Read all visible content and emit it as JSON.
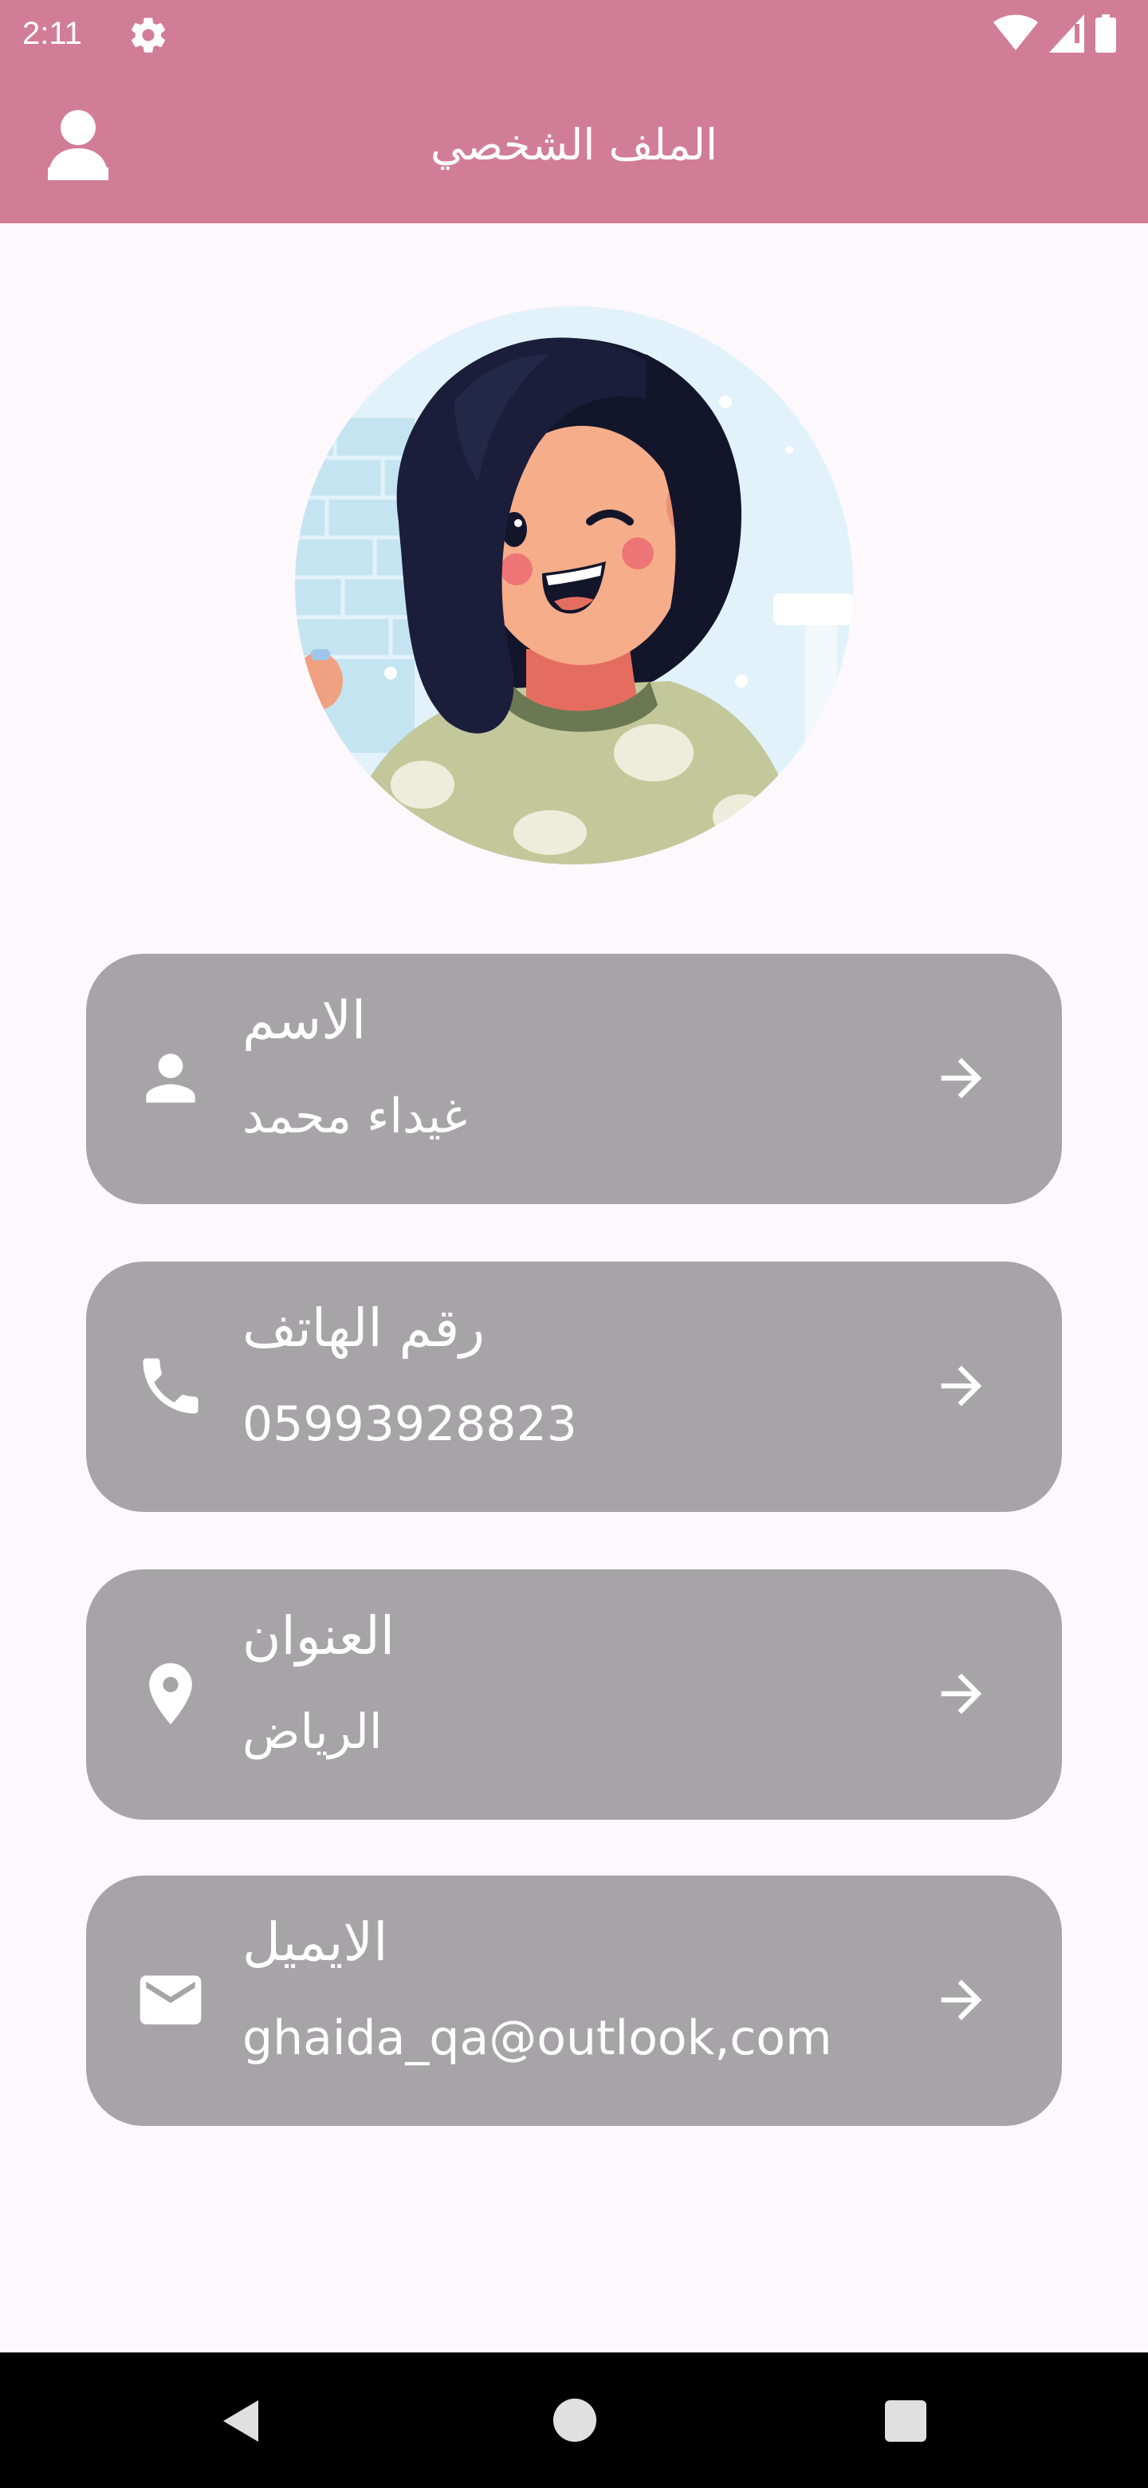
{
  "status_bar": {
    "time": "2:11",
    "icons": [
      "settings-icon",
      "wifi-icon",
      "signal-icon",
      "battery-icon"
    ]
  },
  "app_bar": {
    "title": "الملف الشخصي",
    "leading_icon": "account-icon"
  },
  "profile": {
    "avatar": "illustrated-woman-avatar"
  },
  "cards": [
    {
      "icon": "person-icon",
      "title": "الاسم",
      "value": "غيداء محمد"
    },
    {
      "icon": "phone-icon",
      "title": "رقم الهاتف",
      "value": "05993928823"
    },
    {
      "icon": "location-icon",
      "title": "العنوان",
      "value": "الرياض"
    },
    {
      "icon": "email-icon",
      "title": "الايميل",
      "value": "ghaida_qa@outlook,com"
    }
  ],
  "nav_bar": {
    "buttons": [
      "back-icon",
      "home-icon",
      "recents-icon"
    ]
  },
  "colors": {
    "primary": "#d27d98",
    "card_background": "#a6a4a7",
    "page_background": "#fdf8fb"
  }
}
